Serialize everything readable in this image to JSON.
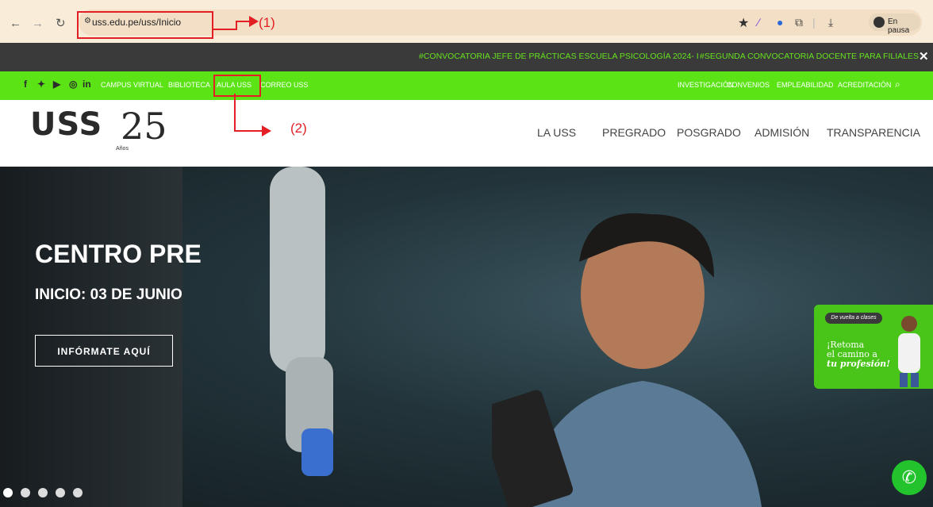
{
  "browser": {
    "url": "uss.edu.pe/uss/Inicio",
    "profile_label": "En pausa",
    "back_icon": "back-arrow-icon",
    "forward_icon": "forward-arrow-icon",
    "reload_icon": "reload-icon"
  },
  "annotations": {
    "label1": "(1)",
    "label2": "(2)"
  },
  "announcement": {
    "item1": "#CONVOCATORIA JEFE DE PRÁCTICAS ESCUELA PSICOLOGÍA 2024- I",
    "item2": "#SEGUNDA CONVOCATORIA DOCENTE PARA FILIALES",
    "close": "✕"
  },
  "utility_bar": {
    "left_links": [
      "CAMPUS VIRTUAL",
      "BIBLIOTECA",
      "AULA USS",
      "CORREO USS"
    ],
    "right_links": [
      "INVESTIGACIÓN",
      "CONVENIOS",
      "EMPLEABILIDAD",
      "ACREDITACIÓN"
    ]
  },
  "header": {
    "logo_text": "USS",
    "logo_number": "25",
    "logo_sub": "Años",
    "nav": [
      "LA USS",
      "PREGRADO",
      "POSGRADO",
      "ADMISIÓN",
      "TRANSPARENCIA"
    ]
  },
  "hero": {
    "title": "CENTRO PRE",
    "subtitle": "INICIO: 03 DE JUNIO",
    "cta": "INFÓRMATE AQUÍ",
    "slide_count": 5
  },
  "promo": {
    "badge": "De vuelta a clases",
    "line1": "¡Retoma",
    "line2": "el camino a",
    "line3": "tu profesión!"
  },
  "colors": {
    "accent_green": "#5be315",
    "announce_bg": "#3a3a3a",
    "annotation_red": "#e31e24"
  }
}
